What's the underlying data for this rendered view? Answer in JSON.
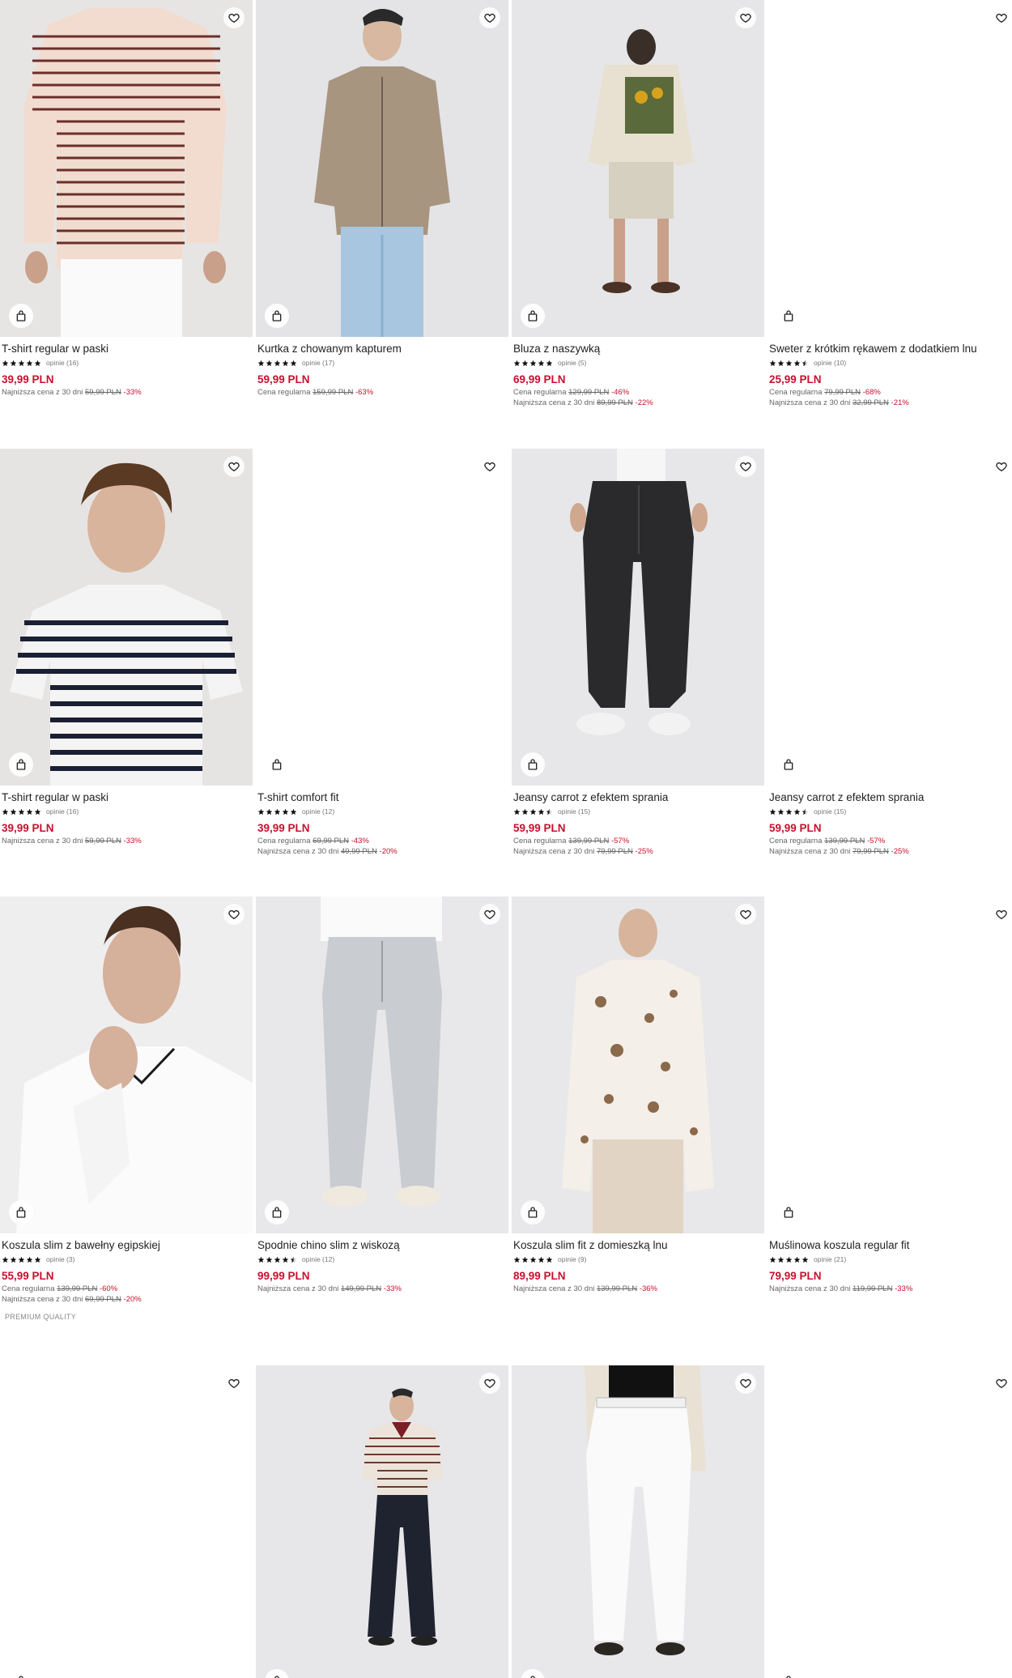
{
  "products": [
    {
      "name": "T-shirt regular w paski",
      "reviews": "opinie (16)",
      "rating": 5,
      "price": "39,99 PLN",
      "lines": [
        {
          "label": "Najniższa cena z 30 dni",
          "old": "59,99 PLN",
          "disc": "-33%"
        }
      ]
    },
    {
      "name": "Kurtka z chowanym kapturem",
      "reviews": "opinie (17)",
      "rating": 5,
      "price": "59,99 PLN",
      "lines": [
        {
          "label": "Cena regularna",
          "old": "159,99 PLN",
          "disc": "-63%"
        }
      ]
    },
    {
      "name": "Bluza z naszywką",
      "reviews": "opinie (5)",
      "rating": 5,
      "price": "69,99 PLN",
      "lines": [
        {
          "label": "Cena regularna",
          "old": "129,99 PLN",
          "disc": "-46%"
        },
        {
          "label": "Najniższa cena z 30 dni",
          "old": "89,99 PLN",
          "disc": "-22%"
        }
      ]
    },
    {
      "name": "Sweter z krótkim rękawem z dodatkiem lnu",
      "reviews": "opinie (10)",
      "rating": 4.5,
      "price": "25,99 PLN",
      "lines": [
        {
          "label": "Cena regularna",
          "old": "79,99 PLN",
          "disc": "-68%"
        },
        {
          "label": "Najniższa cena z 30 dni",
          "old": "32,99 PLN",
          "disc": "-21%"
        }
      ]
    },
    {
      "name": "T-shirt regular w paski",
      "reviews": "opinie (16)",
      "rating": 5,
      "price": "39,99 PLN",
      "lines": [
        {
          "label": "Najniższa cena z 30 dni",
          "old": "59,99 PLN",
          "disc": "-33%"
        }
      ]
    },
    {
      "name": "T-shirt comfort fit",
      "reviews": "opinie (12)",
      "rating": 5,
      "price": "39,99 PLN",
      "lines": [
        {
          "label": "Cena regularna",
          "old": "69,99 PLN",
          "disc": "-43%"
        },
        {
          "label": "Najniższa cena z 30 dni",
          "old": "49,99 PLN",
          "disc": "-20%"
        }
      ]
    },
    {
      "name": "Jeansy carrot z efektem sprania",
      "reviews": "opinie (15)",
      "rating": 4.5,
      "price": "59,99 PLN",
      "lines": [
        {
          "label": "Cena regularna",
          "old": "139,99 PLN",
          "disc": "-57%"
        },
        {
          "label": "Najniższa cena z 30 dni",
          "old": "79,99 PLN",
          "disc": "-25%"
        }
      ]
    },
    {
      "name": "Jeansy carrot z efektem sprania",
      "reviews": "opinie (15)",
      "rating": 4.5,
      "price": "59,99 PLN",
      "lines": [
        {
          "label": "Cena regularna",
          "old": "139,99 PLN",
          "disc": "-57%"
        },
        {
          "label": "Najniższa cena z 30 dni",
          "old": "79,99 PLN",
          "disc": "-25%"
        }
      ]
    },
    {
      "name": "Koszula slim z bawełny egipskiej",
      "reviews": "opinie (3)",
      "rating": 5,
      "price": "55,99 PLN",
      "lines": [
        {
          "label": "Cena regularna",
          "old": "139,99 PLN",
          "disc": "-60%"
        },
        {
          "label": "Najniższa cena z 30 dni",
          "old": "69,99 PLN",
          "disc": "-20%"
        }
      ],
      "badge": "PREMIUM QUALITY"
    },
    {
      "name": "Spodnie chino slim z wiskozą",
      "reviews": "opinie (12)",
      "rating": 4.5,
      "price": "99,99 PLN",
      "lines": [
        {
          "label": "Najniższa cena z 30 dni",
          "old": "149,99 PLN",
          "disc": "-33%"
        }
      ]
    },
    {
      "name": "Koszula slim fit z domieszką lnu",
      "reviews": "opinie (9)",
      "rating": 5,
      "price": "89,99 PLN",
      "lines": [
        {
          "label": "Najniższa cena z 30 dni",
          "old": "139,99 PLN",
          "disc": "-36%"
        }
      ]
    },
    {
      "name": "Muślinowa koszula regular fit",
      "reviews": "opinie (21)",
      "rating": 5,
      "price": "79,99 PLN",
      "lines": [
        {
          "label": "Najniższa cena z 30 dni",
          "old": "119,99 PLN",
          "disc": "-33%"
        }
      ]
    }
  ],
  "colors": {
    "price": "#c8102e",
    "text": "#222222",
    "muted": "#666666",
    "image_bg": "#e9e9ec"
  },
  "icons": {
    "favorite": "heart-icon",
    "cart": "shopping-bag-icon",
    "rating": "star-icon"
  }
}
